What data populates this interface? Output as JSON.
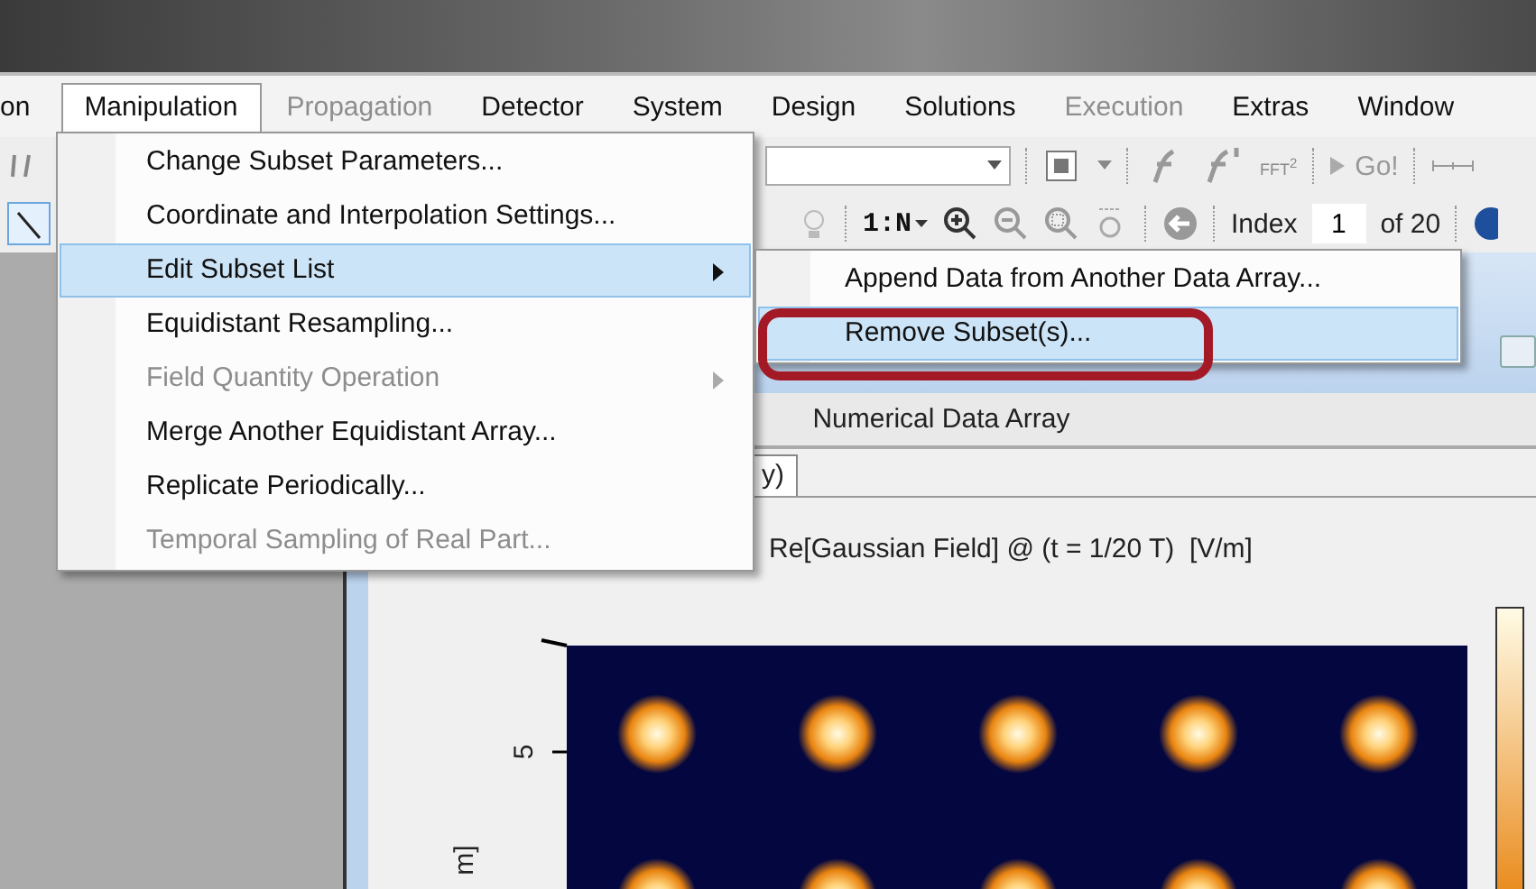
{
  "menu_bar": [
    {
      "label": "on",
      "selected": false,
      "disabled": false
    },
    {
      "label": "Manipulation",
      "selected": true,
      "disabled": false
    },
    {
      "label": "Propagation",
      "selected": false,
      "disabled": true
    },
    {
      "label": "Detector",
      "selected": false,
      "disabled": false
    },
    {
      "label": "System",
      "selected": false,
      "disabled": false
    },
    {
      "label": "Design",
      "selected": false,
      "disabled": false
    },
    {
      "label": "Solutions",
      "selected": false,
      "disabled": false
    },
    {
      "label": "Execution",
      "selected": false,
      "disabled": true
    },
    {
      "label": "Extras",
      "selected": false,
      "disabled": false
    },
    {
      "label": "Window",
      "selected": false,
      "disabled": false
    }
  ],
  "toolbar": {
    "fft_label": "FFT",
    "fft_exponent": "2",
    "go_button": "Go!",
    "ratio_button": "1:N",
    "index_label": "Index",
    "index_value": "1",
    "index_total": "of 20"
  },
  "menu": {
    "items": [
      {
        "label": "Change Subset Parameters...",
        "selected": false,
        "disabled": false,
        "submenu": false
      },
      {
        "label": "Coordinate and Interpolation Settings...",
        "selected": false,
        "disabled": false,
        "submenu": false
      },
      {
        "label": "Edit Subset List",
        "selected": true,
        "disabled": false,
        "submenu": true
      },
      {
        "label": "Equidistant Resampling...",
        "selected": false,
        "disabled": false,
        "submenu": false
      },
      {
        "label": "Field Quantity Operation",
        "selected": false,
        "disabled": true,
        "submenu": true
      },
      {
        "label": "Merge Another Equidistant Array...",
        "selected": false,
        "disabled": false,
        "submenu": false
      },
      {
        "label": "Replicate Periodically...",
        "selected": false,
        "disabled": false,
        "submenu": false
      },
      {
        "label": "Temporal Sampling of Real Part...",
        "selected": false,
        "disabled": true,
        "submenu": false
      }
    ]
  },
  "submenu": {
    "items": [
      {
        "label": "Append Data from Another Data Array...",
        "selected": false
      },
      {
        "label": "Remove Subset(s)...",
        "selected": true
      }
    ]
  },
  "child_window": {
    "title": "Numerical Data Array",
    "tabs": [
      {
        "label": "y)",
        "selected": true
      }
    ],
    "plot": {
      "title": "Re[Gaussian Field] @ (t = 1/20 T)  [V/m]",
      "y_tick": "5",
      "y_label": "m]"
    }
  }
}
